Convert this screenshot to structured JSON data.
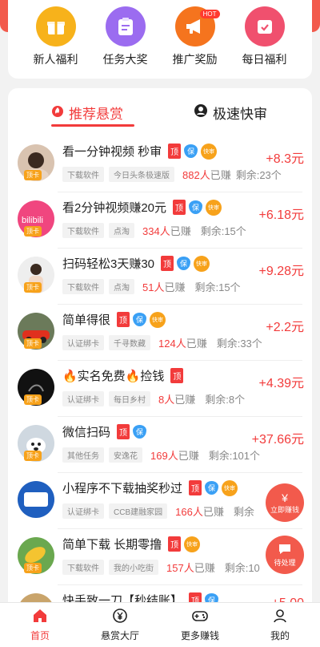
{
  "quick_actions": [
    {
      "label": "新人福利",
      "color": "#f7b21b",
      "icon": "gift-icon"
    },
    {
      "label": "任务大奖",
      "color": "#9b6cf0",
      "icon": "clipboard-icon"
    },
    {
      "label": "推广奖励",
      "color": "#f5741e",
      "icon": "megaphone-icon",
      "badge": "HOT"
    },
    {
      "label": "每日福利",
      "color": "#f0506e",
      "icon": "calendar-check-icon"
    }
  ],
  "tabs": [
    {
      "label": "推荐悬赏",
      "active": true,
      "icon": "flame-icon"
    },
    {
      "label": "极速快审",
      "active": false,
      "icon": "user-icon"
    }
  ],
  "tasks": [
    {
      "title": "看一分钟视频 秒审",
      "ding": "顶",
      "bao": "保",
      "kuai": "快审",
      "cat": "下载软件",
      "src": "今日头条极速版",
      "count": "882人",
      "done_suffix": "已赚",
      "left": "剩余:23个",
      "reward": "+8.3元",
      "avatar_tag": "顶卡"
    },
    {
      "title": "看2分钟视频赚20元",
      "ding": "顶",
      "bao": "保",
      "kuai": "快审",
      "cat": "下载软件",
      "src": "点淘",
      "count": "334人",
      "done_suffix": "已赚",
      "left": "剩余:15个",
      "reward": "+6.18元",
      "avatar_tag": "顶卡"
    },
    {
      "title": "扫码轻松3天赚30",
      "ding": "顶",
      "bao": "保",
      "kuai": "快审",
      "cat": "下载软件",
      "src": "点淘",
      "count": "51人",
      "done_suffix": "已赚",
      "left": "剩余:15个",
      "reward": "+9.28元",
      "avatar_tag": "顶卡"
    },
    {
      "title": "简单得很",
      "ding": "顶",
      "bao": "保",
      "kuai": "快审",
      "cat": "认证绑卡",
      "src": "千寻数藏",
      "count": "124人",
      "done_suffix": "已赚",
      "left": "剩余:33个",
      "reward": "+2.2元",
      "avatar_tag": "顶卡"
    },
    {
      "title": "🔥实名免费🔥捡钱",
      "ding": "顶",
      "bao": "",
      "kuai": "",
      "cat": "认证绑卡",
      "src": "每日乡村",
      "count": "8人",
      "done_suffix": "已赚",
      "left": "剩余:8个",
      "reward": "+4.39元",
      "avatar_tag": "顶卡"
    },
    {
      "title": "微信扫码",
      "ding": "顶",
      "bao": "保",
      "kuai": "",
      "cat": "其他任务",
      "src": "安逸花",
      "count": "169人",
      "done_suffix": "已赚",
      "left": "剩余:101个",
      "reward": "+37.66元",
      "avatar_tag": "顶卡"
    },
    {
      "title": "小程序不下载抽奖秒过",
      "ding": "顶",
      "bao": "保",
      "kuai": "快审",
      "cat": "认证绑卡",
      "src": "CCB建融家园",
      "count": "166人",
      "done_suffix": "已赚",
      "left": "剩余",
      "reward": "",
      "avatar_tag": "顶卡"
    },
    {
      "title": "简单下载 长期零撸",
      "ding": "顶",
      "bao": "",
      "kuai": "快审",
      "cat": "下载软件",
      "src": "我的小吃街",
      "count": "157人",
      "done_suffix": "已赚",
      "left": "剩余:10",
      "reward": "",
      "avatar_tag": "顶卡"
    },
    {
      "title": "快手致一刀【秒结账】",
      "ding": "顶",
      "bao": "保",
      "kuai": "",
      "cat": "",
      "src": "",
      "count": "",
      "done_suffix": "",
      "left": "",
      "reward": "+5.00",
      "avatar_tag": ""
    }
  ],
  "floating": {
    "earn": {
      "symbol": "¥",
      "label": "立即赚钱"
    },
    "pending": {
      "label": "待处理"
    }
  },
  "tabbar": [
    {
      "label": "首页",
      "icon": "home-icon",
      "active": true
    },
    {
      "label": "悬赏大厅",
      "icon": "yen-coin-icon",
      "active": false
    },
    {
      "label": "更多赚钱",
      "icon": "gamepad-icon",
      "active": false
    },
    {
      "label": "我的",
      "icon": "profile-icon",
      "active": false
    }
  ]
}
